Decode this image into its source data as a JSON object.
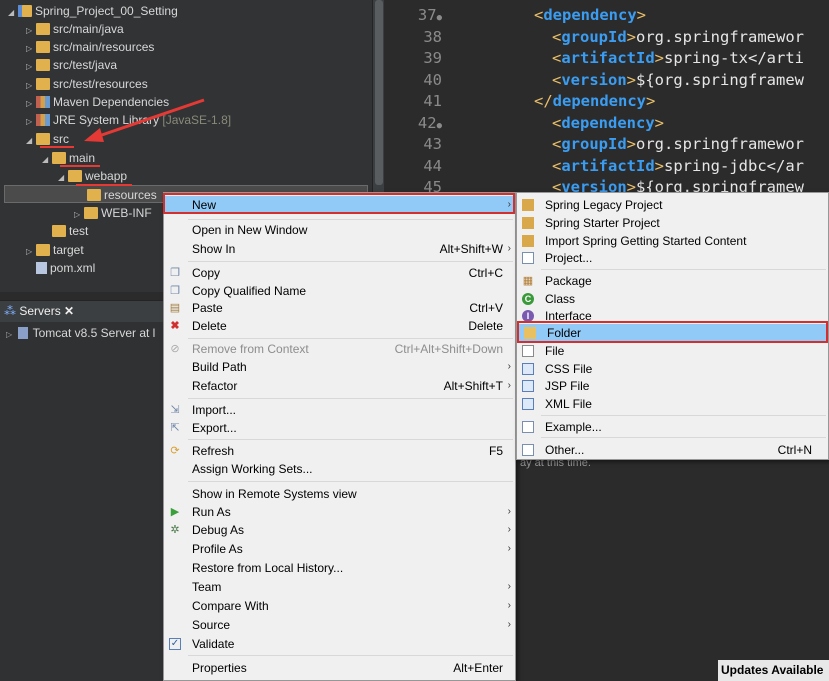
{
  "explorer": {
    "items": [
      {
        "label": "Spring_Project_00_Setting",
        "twisty": "◢",
        "icon": "project-icon"
      },
      {
        "label": "src/main/java",
        "twisty": "▷",
        "icon": "package-folder-icon"
      },
      {
        "label": "src/main/resources",
        "twisty": "▷",
        "icon": "package-folder-icon"
      },
      {
        "label": "src/test/java",
        "twisty": "▷",
        "icon": "package-folder-icon"
      },
      {
        "label": "src/test/resources",
        "twisty": "▷",
        "icon": "package-folder-icon"
      },
      {
        "label": "Maven Dependencies",
        "twisty": "▷",
        "icon": "library-icon"
      },
      {
        "label": "JRE System Library",
        "decoration": "[JavaSE-1.8]",
        "twisty": "▷",
        "icon": "library-icon"
      },
      {
        "label": "src",
        "twisty": "◢",
        "icon": "folder-icon"
      },
      {
        "label": "main",
        "twisty": "◢",
        "icon": "folder-icon"
      },
      {
        "label": "webapp",
        "twisty": "◢",
        "icon": "folder-icon"
      },
      {
        "label": "resources",
        "twisty": "",
        "icon": "folder-icon"
      },
      {
        "label": "WEB-INF",
        "twisty": "▷",
        "icon": "folder-icon"
      },
      {
        "label": "test",
        "twisty": "",
        "icon": "folder-icon"
      },
      {
        "label": "target",
        "twisty": "▷",
        "icon": "folder-icon"
      },
      {
        "label": "pom.xml",
        "twisty": "",
        "icon": "xml-file-icon"
      }
    ]
  },
  "servers": {
    "tab_label": "Servers",
    "close": "✕",
    "row_label": "Tomcat v8.5 Server at l"
  },
  "editor": {
    "lines": [
      {
        "num": "37",
        "fold": "●",
        "tag": "dependency",
        "close": false,
        "text": ""
      },
      {
        "num": "38",
        "fold": "",
        "tag": "groupId",
        "close": false,
        "text": "org.springframewor"
      },
      {
        "num": "39",
        "fold": "",
        "tag": "artifactId",
        "close": false,
        "text": "spring-tx</arti"
      },
      {
        "num": "40",
        "fold": "",
        "tag": "version",
        "close": false,
        "text": "${org.springframew"
      },
      {
        "num": "41",
        "fold": "",
        "tag": "dependency",
        "close": true,
        "text": ""
      },
      {
        "num": "42",
        "fold": "●",
        "tag": "dependency",
        "close": false,
        "text": ""
      },
      {
        "num": "43",
        "fold": "",
        "tag": "groupId",
        "close": false,
        "text": "org.springframewor"
      },
      {
        "num": "44",
        "fold": "",
        "tag": "artifactId",
        "close": false,
        "text": "spring-jdbc</ar"
      },
      {
        "num": "45",
        "fold": "",
        "tag": "version",
        "close": false,
        "text": "${org.springframew"
      }
    ]
  },
  "context_menu": {
    "items": [
      {
        "label": "New",
        "arrow": "›",
        "icon": "",
        "highlight": true
      },
      {
        "label": "Open in New Window"
      },
      {
        "label": "Show In",
        "accel": "Alt+Shift+W",
        "arrow": "›"
      },
      {
        "label": "Copy",
        "accel": "Ctrl+C",
        "icon": "copy-icon"
      },
      {
        "label": "Copy Qualified Name",
        "icon": "copy-qualified-icon"
      },
      {
        "label": "Paste",
        "accel": "Ctrl+V",
        "icon": "paste-icon"
      },
      {
        "label": "Delete",
        "accel": "Delete",
        "icon": "delete-icon"
      },
      {
        "label": "Remove from Context",
        "accel": "Ctrl+Alt+Shift+Down",
        "disabled": true,
        "icon": "remove-context-icon"
      },
      {
        "label": "Build Path",
        "arrow": "›"
      },
      {
        "label": "Refactor",
        "accel": "Alt+Shift+T",
        "arrow": "›"
      },
      {
        "label": "Import...",
        "icon": "import-icon"
      },
      {
        "label": "Export...",
        "icon": "export-icon"
      },
      {
        "label": "Refresh",
        "accel": "F5",
        "icon": "refresh-icon"
      },
      {
        "label": "Assign Working Sets..."
      },
      {
        "label": "Show in Remote Systems view"
      },
      {
        "label": "Run As",
        "arrow": "›",
        "icon": "run-icon"
      },
      {
        "label": "Debug As",
        "arrow": "›",
        "icon": "debug-icon"
      },
      {
        "label": "Profile As",
        "arrow": "›"
      },
      {
        "label": "Restore from Local History..."
      },
      {
        "label": "Team",
        "arrow": "›"
      },
      {
        "label": "Compare With",
        "arrow": "›"
      },
      {
        "label": "Source",
        "arrow": "›"
      },
      {
        "label": "Validate",
        "icon": "validate-check-icon"
      },
      {
        "label": "Properties",
        "accel": "Alt+Enter"
      }
    ]
  },
  "submenu": {
    "items": [
      {
        "label": "Spring Legacy Project",
        "icon": "spring-project-icon"
      },
      {
        "label": "Spring Starter Project",
        "icon": "spring-starter-icon"
      },
      {
        "label": "Import Spring Getting Started Content",
        "icon": "spring-import-icon"
      },
      {
        "label": "Project...",
        "icon": "project-wizard-icon"
      },
      {
        "label": "Package",
        "icon": "package-icon"
      },
      {
        "label": "Class",
        "icon": "class-icon"
      },
      {
        "label": "Interface",
        "icon": "interface-icon"
      },
      {
        "label": "Folder",
        "icon": "folder-icon",
        "highlight": true
      },
      {
        "label": "File",
        "icon": "file-icon"
      },
      {
        "label": "CSS File",
        "icon": "css-file-icon"
      },
      {
        "label": "JSP File",
        "icon": "jsp-file-icon"
      },
      {
        "label": "XML File",
        "icon": "xml-file-icon"
      },
      {
        "label": "Example...",
        "icon": "example-icon"
      },
      {
        "label": "Other...",
        "accel": "Ctrl+N",
        "icon": "other-wizard-icon"
      }
    ]
  },
  "status": {
    "message": "ay at this time.",
    "updates": "Updates Available"
  }
}
